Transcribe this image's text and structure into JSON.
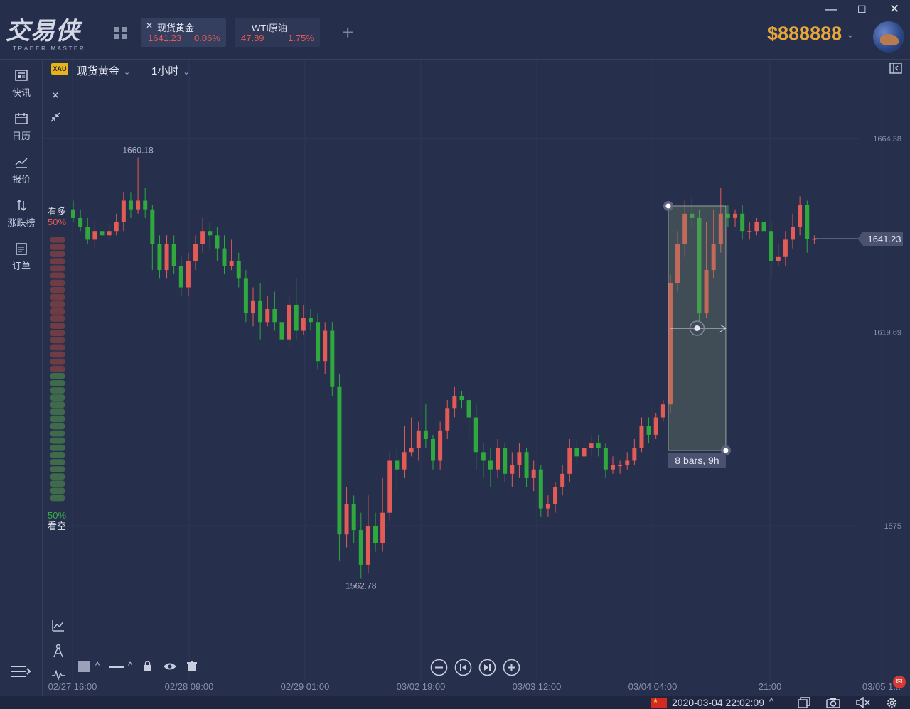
{
  "app": {
    "logo_title": "交易侠",
    "logo_subtitle": "TRADER MASTER",
    "balance": "$888888"
  },
  "tabs": [
    {
      "name": "现货黄金",
      "price": "1641.23",
      "change": "0.06%",
      "closable": true
    },
    {
      "name": "WTI原油",
      "price": "47.89",
      "change": "1.75%",
      "closable": false
    }
  ],
  "window_controls": {
    "minimize": "—",
    "maximize": "☐",
    "close": "✕"
  },
  "sidebar": {
    "items": [
      {
        "label": "快讯",
        "icon": "news-icon"
      },
      {
        "label": "日历",
        "icon": "calendar-icon"
      },
      {
        "label": "报价",
        "icon": "quote-icon"
      },
      {
        "label": "涨跌榜",
        "icon": "ranking-icon"
      },
      {
        "label": "订单",
        "icon": "order-icon"
      }
    ]
  },
  "chart_header": {
    "symbol_code": "XAU",
    "symbol_name": "现货黄金",
    "timeframe": "1小时"
  },
  "sentiment": {
    "bull_label": "看多",
    "bull_pct": "50%",
    "bear_label": "看空",
    "bear_pct": "50%"
  },
  "range_tool": {
    "label": "8 bars, 9h"
  },
  "status": {
    "datetime": "2020-03-04 22:02:09"
  },
  "colors": {
    "up": "#e35b55",
    "down": "#2fa83e",
    "accent": "#e6a63a",
    "bg": "#262f4c"
  },
  "chart_data": {
    "type": "candlestick",
    "symbol": "现货黄金",
    "current_price": 1641.23,
    "high_label": "1660.18",
    "low_label": "1562.78",
    "y_ticks": [
      "1664.38",
      "1619.69",
      "1575"
    ],
    "x_ticks": [
      "02/27 16:00",
      "02/28 09:00",
      "02/29 01:00",
      "03/02 19:00",
      "03/03 12:00",
      "03/04 04:00",
      "21:00",
      "03/05 1..."
    ],
    "ylim": [
      1555,
      1675
    ],
    "candles": [
      [
        1648,
        1646,
        1650,
        1645
      ],
      [
        1646,
        1644,
        1648,
        1643
      ],
      [
        1644,
        1641,
        1646,
        1640
      ],
      [
        1641,
        1643,
        1645,
        1639
      ],
      [
        1643,
        1642,
        1646,
        1640
      ],
      [
        1642,
        1643,
        1645,
        1641
      ],
      [
        1643,
        1645,
        1647,
        1642
      ],
      [
        1645,
        1650,
        1652,
        1643
      ],
      [
        1650,
        1648,
        1652,
        1646
      ],
      [
        1648,
        1650,
        1660,
        1647
      ],
      [
        1650,
        1648,
        1653,
        1646
      ],
      [
        1648,
        1640,
        1649,
        1634
      ],
      [
        1640,
        1634,
        1642,
        1632
      ],
      [
        1634,
        1640,
        1642,
        1632
      ],
      [
        1640,
        1635,
        1642,
        1633
      ],
      [
        1635,
        1630,
        1637,
        1628
      ],
      [
        1630,
        1636,
        1638,
        1628
      ],
      [
        1636,
        1640,
        1642,
        1634
      ],
      [
        1640,
        1643,
        1646,
        1638
      ],
      [
        1643,
        1642,
        1645,
        1639
      ],
      [
        1642,
        1639,
        1644,
        1636
      ],
      [
        1639,
        1635,
        1642,
        1633
      ],
      [
        1635,
        1636,
        1641,
        1634
      ],
      [
        1636,
        1632,
        1638,
        1630
      ],
      [
        1632,
        1624,
        1634,
        1622
      ],
      [
        1624,
        1627,
        1630,
        1621
      ],
      [
        1627,
        1622,
        1631,
        1618
      ],
      [
        1622,
        1625,
        1628,
        1621
      ],
      [
        1625,
        1622,
        1629,
        1620
      ],
      [
        1622,
        1618,
        1625,
        1612
      ],
      [
        1618,
        1626,
        1628,
        1616
      ],
      [
        1626,
        1620,
        1632,
        1618
      ],
      [
        1620,
        1623,
        1626,
        1619
      ],
      [
        1623,
        1622,
        1625,
        1620
      ],
      [
        1622,
        1613,
        1624,
        1611
      ],
      [
        1613,
        1620,
        1622,
        1610
      ],
      [
        1620,
        1607,
        1622,
        1605
      ],
      [
        1607,
        1573,
        1610,
        1567
      ],
      [
        1573,
        1580,
        1584,
        1570
      ],
      [
        1580,
        1574,
        1582,
        1571
      ],
      [
        1574,
        1566,
        1578,
        1562.78
      ],
      [
        1566,
        1575,
        1582,
        1564
      ],
      [
        1575,
        1571,
        1578,
        1569
      ],
      [
        1571,
        1578,
        1586,
        1569
      ],
      [
        1578,
        1590,
        1592,
        1576
      ],
      [
        1590,
        1588,
        1593,
        1583
      ],
      [
        1588,
        1592,
        1598,
        1586
      ],
      [
        1592,
        1593,
        1600,
        1591
      ],
      [
        1593,
        1597,
        1599,
        1590
      ],
      [
        1597,
        1595,
        1603,
        1593
      ],
      [
        1595,
        1590,
        1596,
        1588
      ],
      [
        1590,
        1597,
        1599,
        1588
      ],
      [
        1597,
        1602,
        1604,
        1595
      ],
      [
        1602,
        1605,
        1607,
        1600
      ],
      [
        1605,
        1604,
        1606,
        1602
      ],
      [
        1604,
        1600,
        1605,
        1595
      ],
      [
        1600,
        1592,
        1603,
        1588
      ],
      [
        1592,
        1590,
        1594,
        1586
      ],
      [
        1590,
        1588,
        1593,
        1584
      ],
      [
        1588,
        1593,
        1595,
        1586
      ],
      [
        1593,
        1587,
        1594,
        1585
      ],
      [
        1587,
        1589,
        1592,
        1584
      ],
      [
        1589,
        1592,
        1594,
        1586
      ],
      [
        1592,
        1586,
        1593,
        1584
      ],
      [
        1586,
        1588,
        1590,
        1583
      ],
      [
        1588,
        1579,
        1589,
        1577
      ],
      [
        1579,
        1580,
        1582,
        1577
      ],
      [
        1580,
        1584,
        1585,
        1578
      ],
      [
        1584,
        1587,
        1589,
        1582
      ],
      [
        1587,
        1593,
        1595,
        1585
      ],
      [
        1593,
        1591,
        1595,
        1589
      ],
      [
        1591,
        1593,
        1595,
        1590
      ],
      [
        1593,
        1594,
        1596,
        1591
      ],
      [
        1594,
        1593,
        1596,
        1591
      ],
      [
        1593,
        1588,
        1594,
        1586
      ],
      [
        1588,
        1589,
        1591,
        1587
      ],
      [
        1589,
        1589,
        1590,
        1587
      ],
      [
        1589,
        1590,
        1592,
        1588
      ],
      [
        1590,
        1593,
        1595,
        1589
      ],
      [
        1593,
        1598,
        1600,
        1592
      ],
      [
        1598,
        1596,
        1600,
        1594
      ],
      [
        1596,
        1600,
        1601,
        1595
      ],
      [
        1600,
        1603,
        1604,
        1599
      ],
      [
        1603,
        1631,
        1633,
        1601
      ],
      [
        1631,
        1640,
        1643,
        1629
      ],
      [
        1640,
        1647,
        1650,
        1637
      ],
      [
        1647,
        1646,
        1651,
        1644
      ],
      [
        1646,
        1624,
        1648,
        1622
      ],
      [
        1624,
        1634,
        1645,
        1623
      ],
      [
        1634,
        1640,
        1648,
        1632
      ],
      [
        1640,
        1647,
        1653,
        1638
      ],
      [
        1647,
        1646,
        1649,
        1644
      ],
      [
        1646,
        1647,
        1648,
        1644
      ],
      [
        1647,
        1643,
        1649,
        1641
      ],
      [
        1643,
        1643,
        1645,
        1641
      ],
      [
        1643,
        1645,
        1646,
        1642
      ],
      [
        1645,
        1643,
        1646,
        1640
      ],
      [
        1643,
        1636,
        1645,
        1632
      ],
      [
        1636,
        1637,
        1640,
        1635
      ],
      [
        1637,
        1641,
        1643,
        1635
      ],
      [
        1641,
        1644,
        1647,
        1639
      ],
      [
        1644,
        1649,
        1651,
        1642
      ],
      [
        1649,
        1641.23,
        1650,
        1638
      ],
      [
        1641.23,
        1641.23,
        1642,
        1640
      ]
    ]
  }
}
